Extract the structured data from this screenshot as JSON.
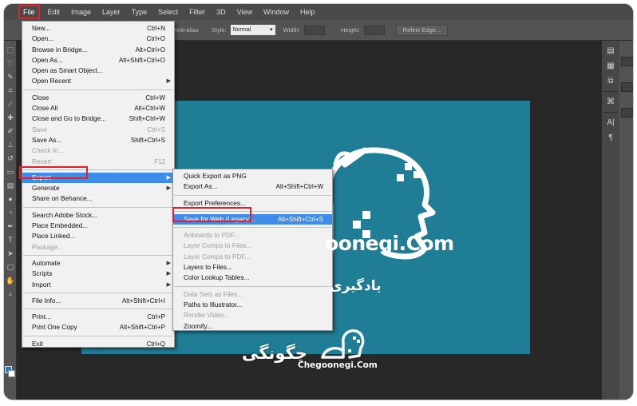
{
  "menubar": {
    "items": [
      "File",
      "Edit",
      "Image",
      "Layer",
      "Type",
      "Select",
      "Filter",
      "3D",
      "View",
      "Window",
      "Help"
    ]
  },
  "options_bar": {
    "anti_alias_label": "Anti-alias",
    "style_label": "Style:",
    "style_value": "Normal",
    "width_label": "Width:",
    "height_label": "Height:",
    "refine_edge_label": "Refine Edge..."
  },
  "file_menu": {
    "items": [
      {
        "label": "New...",
        "shortcut": "Ctrl+N"
      },
      {
        "label": "Open...",
        "shortcut": "Ctrl+O"
      },
      {
        "label": "Browse in Bridge...",
        "shortcut": "Alt+Ctrl+O"
      },
      {
        "label": "Open As...",
        "shortcut": "Alt+Shift+Ctrl+O"
      },
      {
        "label": "Open as Smart Object...",
        "shortcut": ""
      },
      {
        "label": "Open Recent",
        "shortcut": ""
      },
      {
        "label": "Close",
        "shortcut": "Ctrl+W"
      },
      {
        "label": "Close All",
        "shortcut": "Alt+Ctrl+W"
      },
      {
        "label": "Close and Go to Bridge...",
        "shortcut": "Shift+Ctrl+W"
      },
      {
        "label": "Save",
        "shortcut": "Ctrl+S"
      },
      {
        "label": "Save As...",
        "shortcut": "Shift+Ctrl+S"
      },
      {
        "label": "Check In...",
        "shortcut": ""
      },
      {
        "label": "Revert",
        "shortcut": "F12"
      },
      {
        "label": "Export",
        "shortcut": ""
      },
      {
        "label": "Generate",
        "shortcut": ""
      },
      {
        "label": "Share on Behance...",
        "shortcut": ""
      },
      {
        "label": "Search Adobe Stock...",
        "shortcut": ""
      },
      {
        "label": "Place Embedded...",
        "shortcut": ""
      },
      {
        "label": "Place Linked...",
        "shortcut": ""
      },
      {
        "label": "Package...",
        "shortcut": ""
      },
      {
        "label": "Automate",
        "shortcut": ""
      },
      {
        "label": "Scripts",
        "shortcut": ""
      },
      {
        "label": "Import",
        "shortcut": ""
      },
      {
        "label": "File Info...",
        "shortcut": "Alt+Shift+Ctrl+I"
      },
      {
        "label": "Print...",
        "shortcut": "Ctrl+P"
      },
      {
        "label": "Print One Copy",
        "shortcut": "Alt+Shift+Ctrl+P"
      },
      {
        "label": "Exit",
        "shortcut": "Ctrl+Q"
      }
    ]
  },
  "export_menu": {
    "items": [
      {
        "label": "Quick Export as PNG",
        "shortcut": ""
      },
      {
        "label": "Export As...",
        "shortcut": "Alt+Shift+Ctrl+W"
      },
      {
        "label": "Export Preferences...",
        "shortcut": ""
      },
      {
        "label": "Save for Web (Legacy)...",
        "shortcut": "Alt+Shift+Ctrl+S"
      },
      {
        "label": "Artboards to PDF...",
        "shortcut": ""
      },
      {
        "label": "Layer Comps to Files...",
        "shortcut": ""
      },
      {
        "label": "Layer Comps to PDF...",
        "shortcut": ""
      },
      {
        "label": "Layers to Files...",
        "shortcut": ""
      },
      {
        "label": "Color Lookup Tables...",
        "shortcut": ""
      },
      {
        "label": "Data Sets as Files...",
        "shortcut": ""
      },
      {
        "label": "Paths to Illustrator...",
        "shortcut": ""
      },
      {
        "label": "Render Video...",
        "shortcut": ""
      },
      {
        "label": "Zoomify...",
        "shortcut": ""
      }
    ]
  },
  "canvas": {
    "logo_text": "oonegi.Com",
    "logo_subtitle_fa": "یادگیری"
  },
  "watermark": {
    "fa_text": "چگونگی",
    "en_text": "Chegoonegi.Com"
  },
  "colors": {
    "canvas_bg": "#1f7d96",
    "highlight": "#3f8bea",
    "callout_red": "#e3202a",
    "foreground_swatch": "#1a7fd0"
  }
}
